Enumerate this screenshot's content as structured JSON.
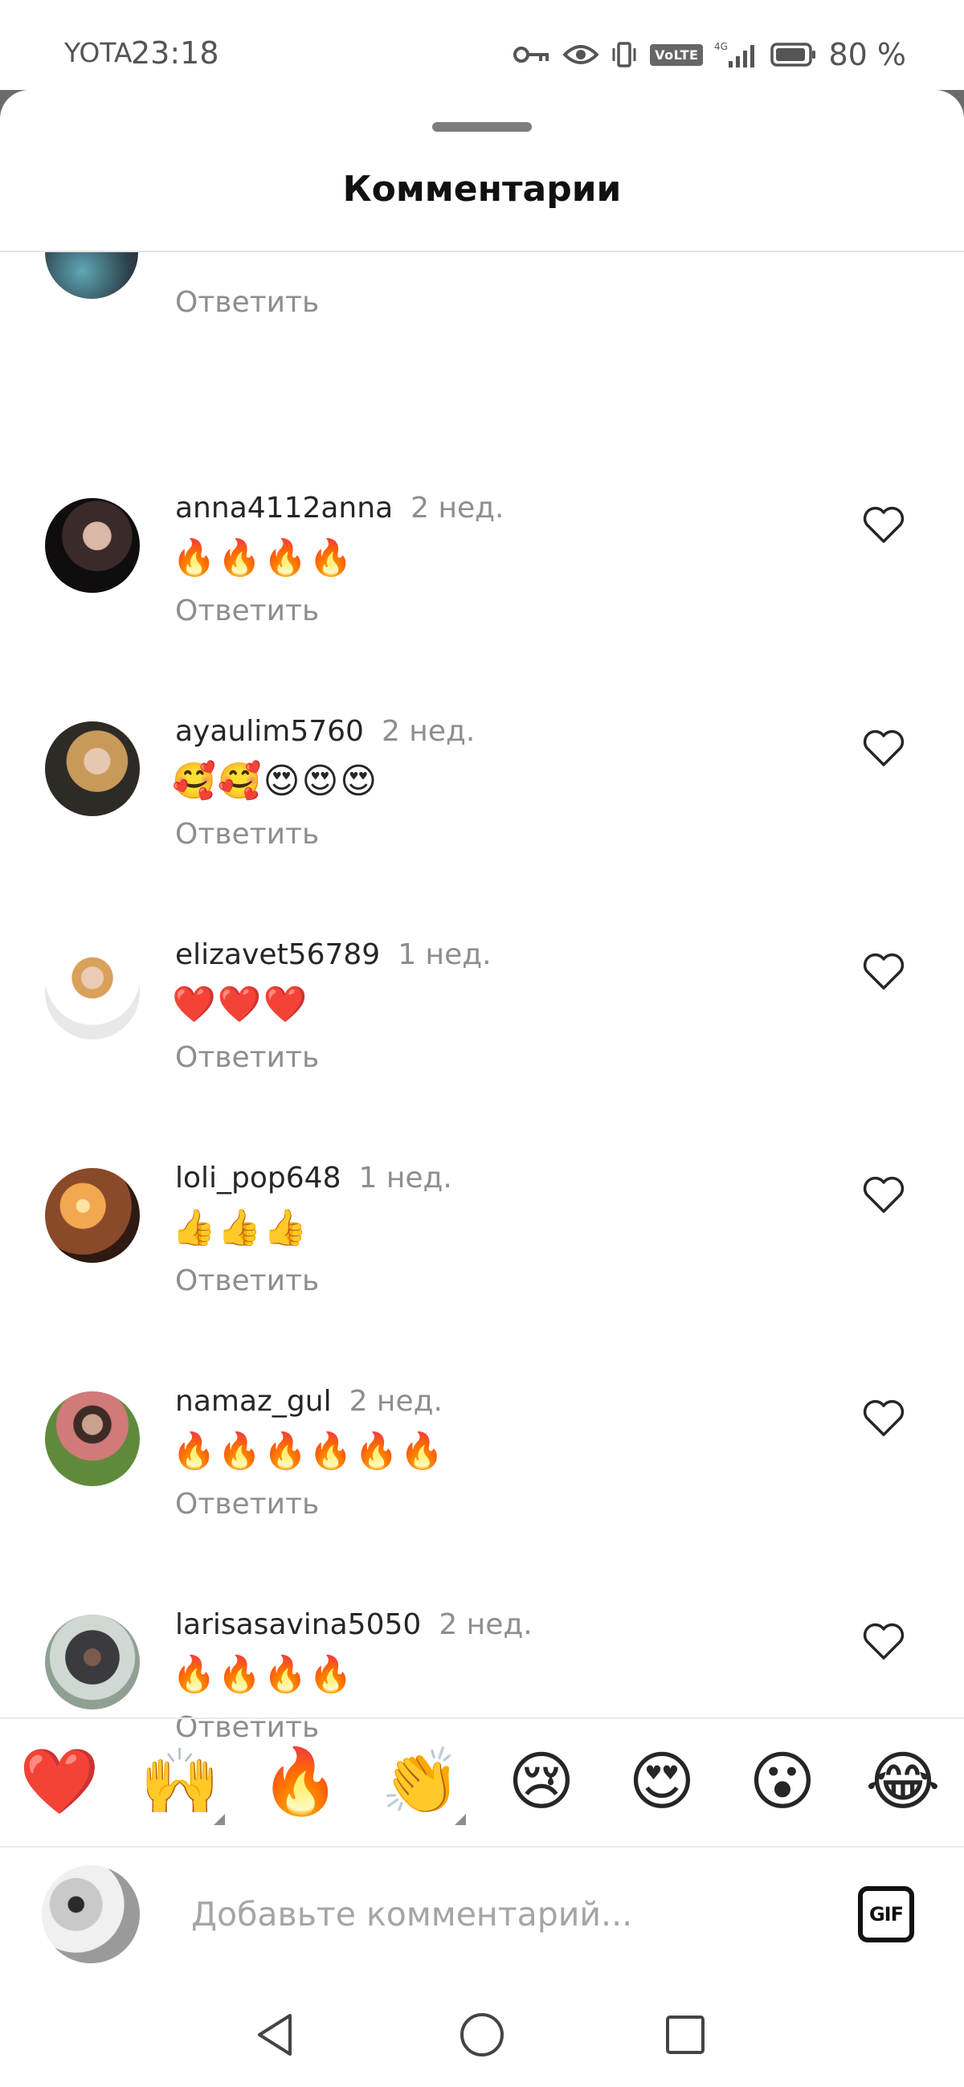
{
  "status_bar": {
    "carrier": "YOTA",
    "time": "23:18",
    "volte": "VoLTE",
    "network": "4G",
    "battery": "80 %"
  },
  "sheet": {
    "title": "Комментарии"
  },
  "partial_comment": {
    "reply_label": "Ответить"
  },
  "comments": [
    {
      "username": "anna4112anna",
      "time": "2 нед.",
      "text": "🔥🔥🔥🔥",
      "reply_label": "Ответить"
    },
    {
      "username": "ayaulim5760",
      "time": "2 нед.",
      "text": "🥰🥰😍😍😍",
      "reply_label": "Ответить"
    },
    {
      "username": "elizavet56789",
      "time": "1 нед.",
      "text": "❤️❤️❤️",
      "reply_label": "Ответить"
    },
    {
      "username": "loli_pop648",
      "time": "1 нед.",
      "text": "👍👍👍",
      "reply_label": "Ответить"
    },
    {
      "username": "namaz_gul",
      "time": "2 нед.",
      "text": "🔥🔥🔥🔥🔥🔥",
      "reply_label": "Ответить"
    },
    {
      "username": "larisasavina5050",
      "time": "2 нед.",
      "text": "🔥🔥🔥🔥",
      "reply_label": "Ответить"
    }
  ],
  "reactions": [
    "❤️",
    "🙌",
    "🔥",
    "👏",
    "😢",
    "😍",
    "😮",
    "😂"
  ],
  "composer": {
    "placeholder": "Добавьте комментарий...",
    "gif_label": "GIF"
  },
  "colors": {
    "text_primary": "#262626",
    "text_secondary": "#8e8e8e",
    "placeholder": "#a5a5a5",
    "divider": "#e3e3e3",
    "backdrop": "#6b6b6b"
  }
}
